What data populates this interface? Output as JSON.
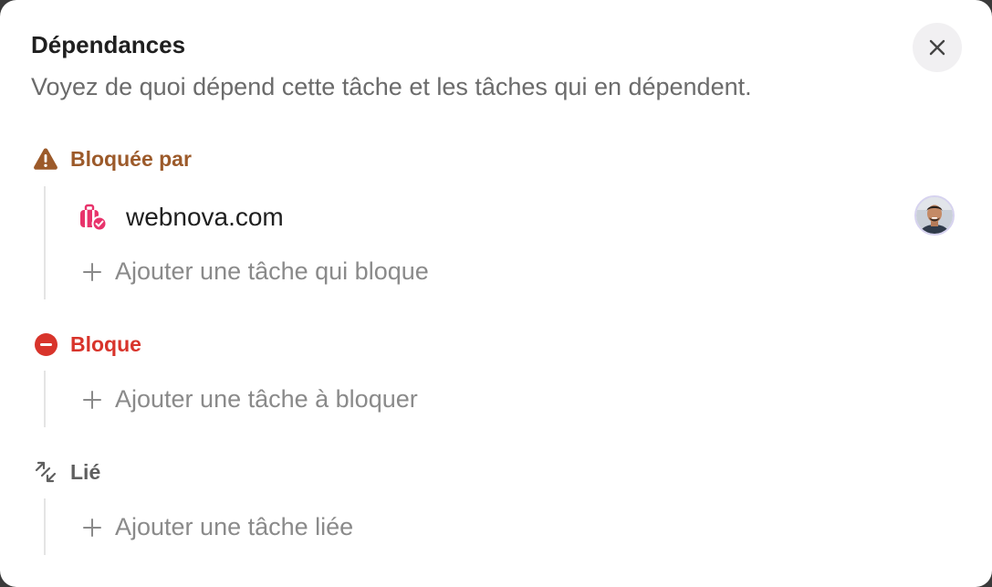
{
  "dialog": {
    "title": "Dépendances",
    "subtitle": "Voyez de quoi dépend cette tâche et les tâches qui en dépendent."
  },
  "sections": {
    "blocked_by": {
      "label": "Bloquée par",
      "icon": "warning-triangle-icon",
      "color": "#9c5a2a",
      "tasks": [
        {
          "label": "webnova.com",
          "icon": "briefcase-check-icon"
        }
      ],
      "add_label": "Ajouter une tâche qui bloque"
    },
    "blocks": {
      "label": "Bloque",
      "icon": "minus-circle-icon",
      "color": "#d8342b",
      "add_label": "Ajouter une tâche à bloquer"
    },
    "related": {
      "label": "Lié",
      "icon": "arrows-link-icon",
      "color": "#5f5f5f",
      "add_label": "Ajouter une tâche liée"
    }
  }
}
